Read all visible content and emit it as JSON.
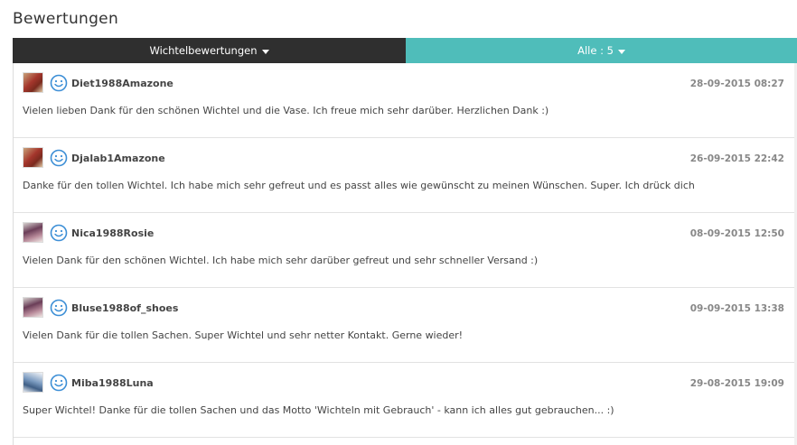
{
  "page": {
    "title": "Bewertungen"
  },
  "tabs": {
    "left_label": "Wichtelbewertungen",
    "right_label": "Alle : 5"
  },
  "colors": {
    "dark_tab": "#2f2f2f",
    "accent_tab": "#4fbdba",
    "smiley": "#3d8fd6"
  },
  "reviews": [
    {
      "user": "Diet1988Amazone",
      "date": "28-09-2015 08:27",
      "icon": "smiley-icon",
      "comment": "Vielen lieben Dank für den schönen Wichtel und die Vase. Ich freue mich sehr darüber. Herzlichen Dank :)"
    },
    {
      "user": "Djalab1Amazone",
      "date": "26-09-2015 22:42",
      "icon": "smiley-icon",
      "comment": "Danke für den tollen Wichtel. Ich habe mich sehr gefreut und es passt alles wie gewünscht zu meinen Wünschen. Super. Ich drück dich"
    },
    {
      "user": "Nica1988Rosie",
      "date": "08-09-2015 12:50",
      "icon": "smiley-icon",
      "comment": "Vielen Dank für den schönen Wichtel. Ich habe mich sehr darüber gefreut und sehr schneller Versand :)"
    },
    {
      "user": "Bluse1988of_shoes",
      "date": "09-09-2015 13:38",
      "icon": "smiley-icon",
      "comment": "Vielen Dank für die tollen Sachen. Super Wichtel und sehr netter Kontakt. Gerne wieder!"
    },
    {
      "user": "Miba1988Luna",
      "date": "29-08-2015 19:09",
      "icon": "smiley-icon",
      "comment": "Super Wichtel! Danke für die tollen Sachen und das Motto 'Wichteln mit Gebrauch' - kann ich alles gut gebrauchen... :)"
    }
  ]
}
